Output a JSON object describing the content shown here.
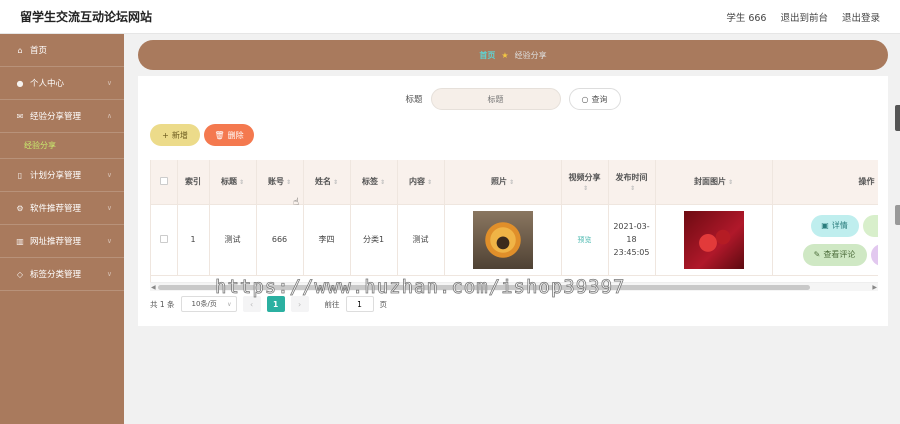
{
  "header": {
    "site_title": "留学生交流互动论坛网站",
    "user_label": "学生 666",
    "to_front_label": "退出到前台",
    "logout_label": "退出登录"
  },
  "sidebar": {
    "items": [
      {
        "label": "首页",
        "icon": "home-icon"
      },
      {
        "label": "个人中心",
        "icon": "user-icon"
      },
      {
        "label": "经验分享管理",
        "icon": "mail-icon"
      },
      {
        "label": "经验分享",
        "icon": ""
      },
      {
        "label": "计划分享管理",
        "icon": "doc-icon"
      },
      {
        "label": "软件推荐管理",
        "icon": "gear-icon"
      },
      {
        "label": "网址推荐管理",
        "icon": "chart-icon"
      },
      {
        "label": "标签分类管理",
        "icon": "tag-icon"
      }
    ]
  },
  "breadcrumb": {
    "home": "首页",
    "current": "经验分享"
  },
  "search": {
    "label": "标题",
    "placeholder": "标题",
    "button_label": "查询"
  },
  "actions": {
    "add_label": "新增",
    "delete_label": "删除"
  },
  "table": {
    "headers": {
      "index": "索引",
      "title": "标题",
      "account": "账号",
      "name": "姓名",
      "tag": "标签",
      "content": "内容",
      "photo": "照片",
      "video": "视频分享",
      "time": "发布时间",
      "cover": "封面图片",
      "ops": "操作"
    },
    "rows": [
      {
        "index": "1",
        "title": "测试",
        "account": "666",
        "name": "李四",
        "tag": "分类1",
        "content": "测试",
        "video": "预览",
        "time": "2021-03-18 23:45:05",
        "ops": {
          "detail": "详情",
          "edit": "修",
          "comment": "查看评论",
          "extra": ""
        }
      }
    ]
  },
  "pager": {
    "total": "共 1 条",
    "page_size": "10条/页",
    "current": "1",
    "goto_label": "前往",
    "goto_value": "1",
    "page_unit": "页"
  },
  "watermark": "https://www.huzhan.com/ishop39397"
}
